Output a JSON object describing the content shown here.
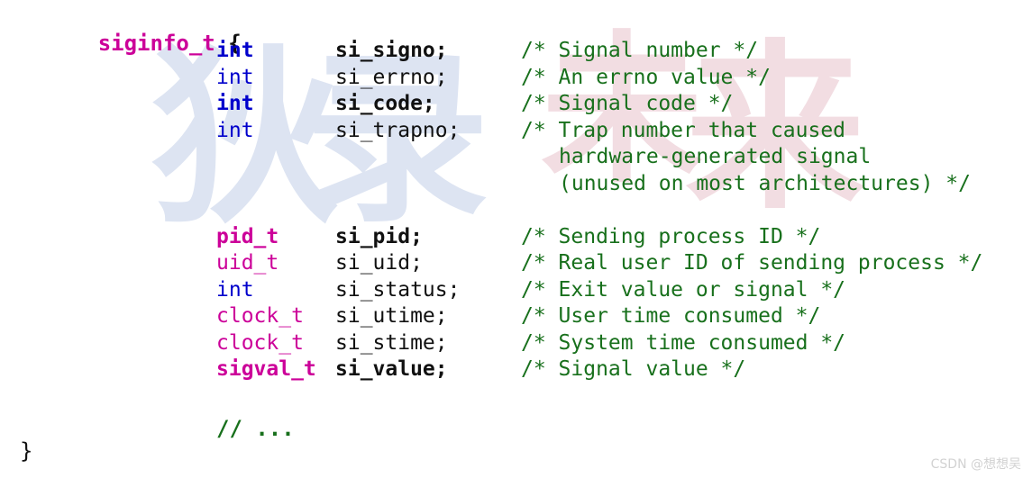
{
  "code": {
    "struct_header": {
      "type_name": "siginfo_t",
      "brace": " {"
    },
    "closing_brace": "}",
    "trailing_comment": "// ...",
    "fields": [
      {
        "type": "int",
        "type_kind": "builtin",
        "type_bold": true,
        "name": "si_signo;",
        "name_bold": true,
        "comment": "/* Signal number */",
        "comment_continuation": []
      },
      {
        "type": "int",
        "type_kind": "builtin",
        "type_bold": false,
        "name": "si_errno;",
        "name_bold": false,
        "comment": "/* An errno value */",
        "comment_continuation": []
      },
      {
        "type": "int",
        "type_kind": "builtin",
        "type_bold": true,
        "name": "si_code;",
        "name_bold": true,
        "comment": "/* Signal code */",
        "comment_continuation": []
      },
      {
        "type": "int",
        "type_kind": "builtin",
        "type_bold": false,
        "name": "si_trapno;",
        "name_bold": false,
        "comment": "/* Trap number that caused",
        "comment_continuation": [
          "hardware-generated signal",
          "(unused on most architectures) */"
        ]
      },
      {
        "type": "pid_t",
        "type_kind": "custom",
        "type_bold": true,
        "name": "si_pid;",
        "name_bold": true,
        "comment": "/* Sending process ID */",
        "comment_continuation": []
      },
      {
        "type": "uid_t",
        "type_kind": "custom",
        "type_bold": false,
        "name": "si_uid;",
        "name_bold": false,
        "comment": "/* Real user ID of sending process */",
        "comment_continuation": []
      },
      {
        "type": "int",
        "type_kind": "builtin",
        "type_bold": false,
        "name": "si_status;",
        "name_bold": false,
        "comment": "/* Exit value or signal */",
        "comment_continuation": []
      },
      {
        "type": "clock_t",
        "type_kind": "custom",
        "type_bold": false,
        "name": "si_utime;",
        "name_bold": false,
        "comment": "/* User time consumed */",
        "comment_continuation": []
      },
      {
        "type": "clock_t",
        "type_kind": "custom",
        "type_bold": false,
        "name": "si_stime;",
        "name_bold": false,
        "comment": "/* System time consumed */",
        "comment_continuation": []
      },
      {
        "type": "sigval_t",
        "type_kind": "custom",
        "type_bold": true,
        "name": "si_value;",
        "name_bold": true,
        "comment": "/* Signal value */",
        "comment_continuation": []
      }
    ]
  },
  "watermark": {
    "blue_chars": [
      "狄",
      "录"
    ],
    "pink_chars": [
      "未",
      "来"
    ],
    "blue_color": "#dde4f2",
    "pink_color": "#f2dde2"
  },
  "attribution": {
    "text": "CSDN @想想吴",
    "color": "#d2d2d2"
  },
  "colors": {
    "background": "#ffffff",
    "builtin_type": "#0000cc",
    "custom_type": "#cc0099",
    "identifier": "#111111",
    "comment": "#18701c"
  }
}
